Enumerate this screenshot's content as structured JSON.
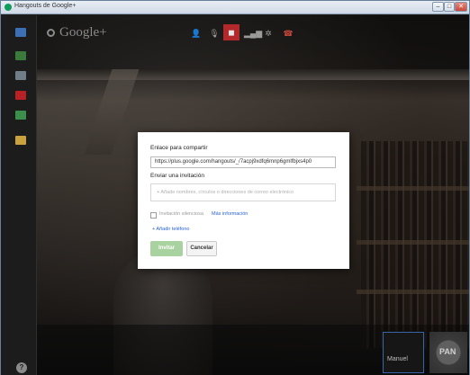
{
  "window": {
    "title": "Hangouts de Google+",
    "controls": {
      "minimize": "–",
      "maximize": "□",
      "close": "✕"
    }
  },
  "app": {
    "logo_text": "Google+"
  },
  "toolbar": {
    "icons": [
      "invite-icon",
      "mic-icon",
      "camera-off-icon",
      "signal-icon",
      "settings-icon",
      "hangup-icon"
    ],
    "glyphs": {
      "invite": "👤",
      "mic": "🎙",
      "camera": "◼",
      "signal": "▂▄▆",
      "settings": "✲",
      "hangup": "☎"
    },
    "camera_off_color": "#b2282b"
  },
  "sidebar": {
    "items": [
      {
        "icon": "chat-icon",
        "color": "#3d6fb8"
      },
      {
        "icon": "screenshare-icon",
        "color": "#3a7a3a"
      },
      {
        "icon": "capture-icon",
        "color": "#6f7d89"
      },
      {
        "icon": "youtube-icon",
        "color": "#b72024"
      },
      {
        "icon": "drive-icon",
        "color": "#3a8f4a"
      },
      {
        "icon": "sketch-icon",
        "color": "#c9a23b"
      }
    ],
    "help_label": "?"
  },
  "dialog": {
    "share_link_label": "Enlace para compartir",
    "share_link_value": "https://plus.google.com/hangouts/_/7acpj9xdfq6mnp6gmlfbjxs4p0",
    "invite_label": "Enviar una invitación",
    "invite_placeholder": "+ Añade nombres, círculos o direcciones de correo electrónico",
    "silent_invite_label": "Invitación silenciosa",
    "more_info_link": "Más información",
    "add_phone_link": "+ Añadir teléfono",
    "invite_button": "Invitar",
    "cancel_button": "Cancelar"
  },
  "filmstrip": {
    "self_name": "Manuel",
    "other_avatar_text": "PAN"
  }
}
